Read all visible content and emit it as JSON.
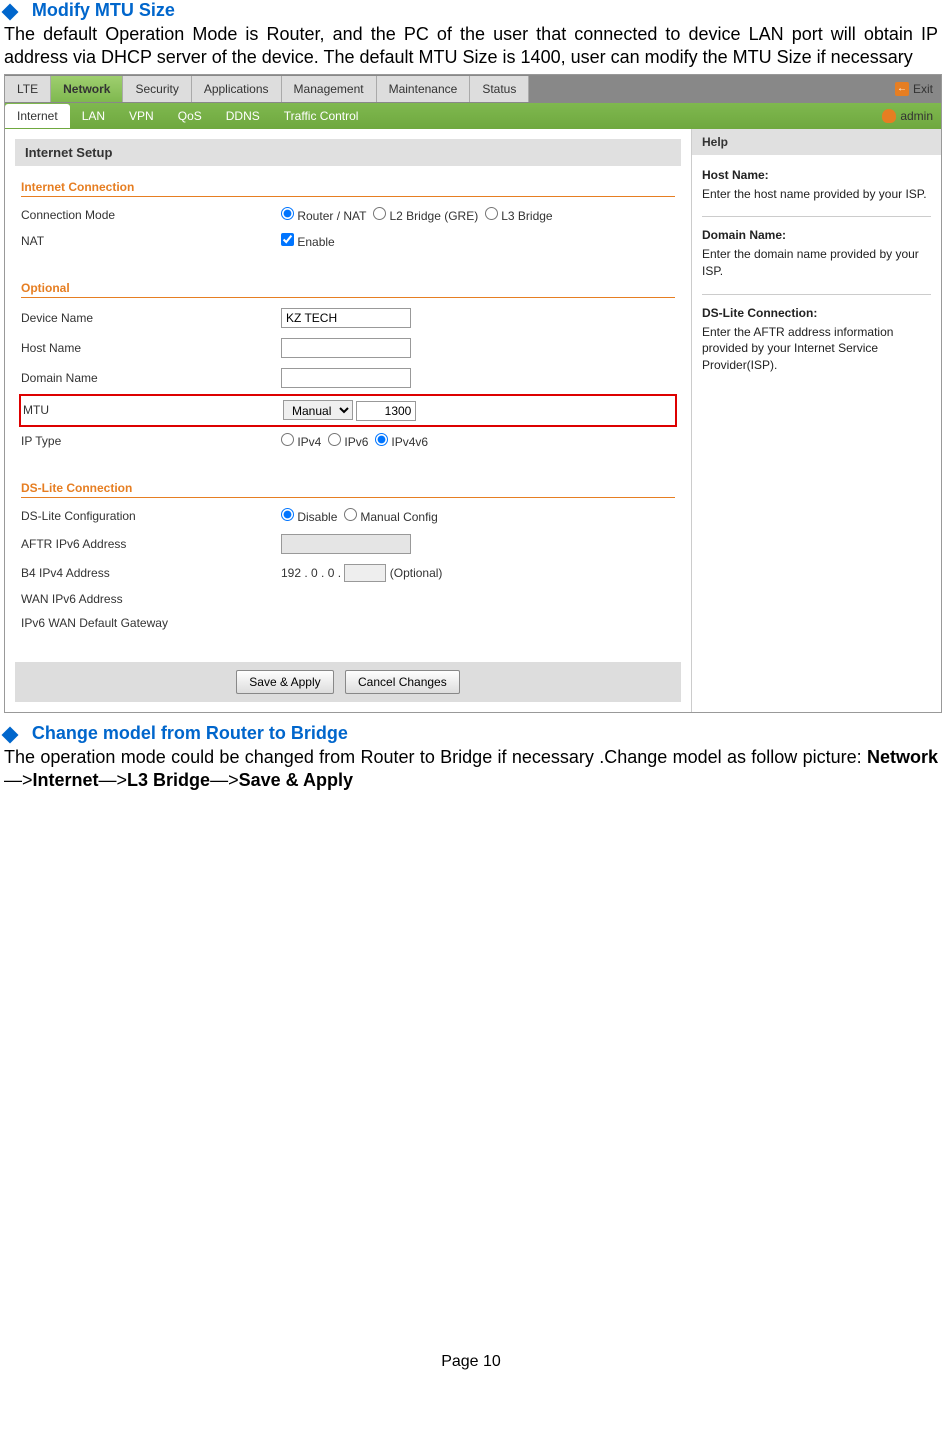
{
  "headings": {
    "h1": "Modify MTU Size",
    "p1": "The default Operation Mode is Router, and the PC of the user that connected to device LAN port will obtain IP address via DHCP server of the device. The default MTU Size is 1400, user can modify the MTU Size if necessary",
    "h2": "Change model from Router to Bridge",
    "p2_a": "The operation mode could be changed from Router to Bridge if necessary .Change model as follow picture: ",
    "p2_b": "Network",
    "p2_c": "Internet",
    "p2_d": "L3 Bridge",
    "p2_e": "Save & Apply",
    "arrow": "—>"
  },
  "ui": {
    "top_tabs": [
      "LTE",
      "Network",
      "Security",
      "Applications",
      "Management",
      "Maintenance",
      "Status"
    ],
    "top_active_index": 1,
    "exit_label": "Exit",
    "sub_tabs": [
      "Internet",
      "LAN",
      "VPN",
      "QoS",
      "DDNS",
      "Traffic Control"
    ],
    "sub_active_index": 0,
    "admin_label": "admin",
    "section_title": "Internet Setup",
    "help_title": "Help",
    "fieldsets": {
      "internet_connection": {
        "legend": "Internet Connection",
        "rows": {
          "connection_mode_label": "Connection Mode",
          "connection_mode_opts": [
            "Router / NAT",
            "L2 Bridge (GRE)",
            "L3 Bridge"
          ],
          "nat_label": "NAT",
          "nat_enable": "Enable"
        }
      },
      "optional": {
        "legend": "Optional",
        "device_name_label": "Device Name",
        "device_name_value": "KZ TECH",
        "host_name_label": "Host Name",
        "host_name_value": "",
        "domain_name_label": "Domain Name",
        "domain_name_value": "",
        "mtu_label": "MTU",
        "mtu_mode": "Manual",
        "mtu_value": "1300",
        "ip_type_label": "IP Type",
        "ip_type_opts": [
          "IPv4",
          "IPv6",
          "IPv4v6"
        ]
      },
      "dslite": {
        "legend": "DS-Lite Connection",
        "config_label": "DS-Lite Configuration",
        "config_opts": [
          "Disable",
          "Manual Config"
        ],
        "aftr_label": "AFTR IPv6 Address",
        "b4_label": "B4 IPv4 Address",
        "b4_prefix": "192 . 0 . 0 .",
        "b4_optional": "(Optional)",
        "wan6_label": "WAN IPv6 Address",
        "gw_label": "IPv6 WAN Default Gateway"
      }
    },
    "buttons": {
      "save": "Save & Apply",
      "cancel": "Cancel Changes"
    },
    "help": {
      "host_name_t": "Host Name:",
      "host_name_d": "Enter the host name provided by your ISP.",
      "domain_name_t": "Domain Name:",
      "domain_name_d": "Enter the domain name provided by your ISP.",
      "dslite_t": "DS-Lite Connection:",
      "dslite_d": "Enter the AFTR address information provided by your Internet Service Provider(ISP)."
    }
  },
  "page_number": "Page 10"
}
